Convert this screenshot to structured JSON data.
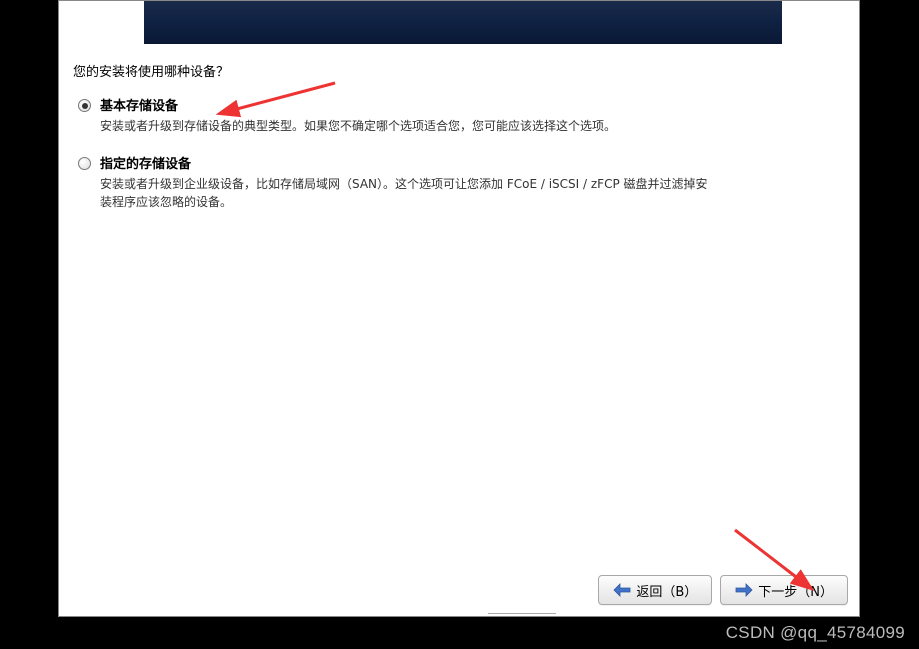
{
  "question": "您的安装将使用哪种设备？",
  "options": {
    "basic": {
      "title": "基本存储设备",
      "desc": "安装或者升级到存储设备的典型类型。如果您不确定哪个选项适合您，您可能应该选择这个选项。",
      "checked": true
    },
    "specified": {
      "title": "指定的存储设备",
      "desc": "安装或者升级到企业级设备，比如存储局域网（SAN）。这个选项可让您添加 FCoE / iSCSI / zFCP 磁盘并过滤掉安装程序应该忽略的设备。",
      "checked": false
    }
  },
  "buttons": {
    "back": "返回（B）",
    "next": "下一步（N）"
  },
  "watermark": "CSDN @qq_45784099"
}
